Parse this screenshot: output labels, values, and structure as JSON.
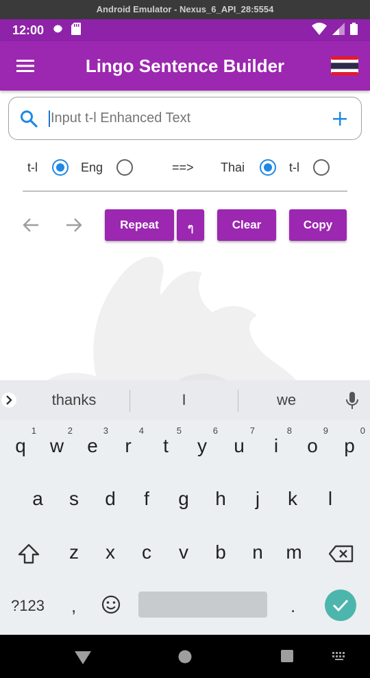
{
  "emulator": {
    "title": "Android Emulator - Nexus_6_API_28:5554"
  },
  "status": {
    "time": "12:00"
  },
  "appbar": {
    "title": "Lingo Sentence Builder"
  },
  "search": {
    "placeholder": "Input t-l Enhanced Text"
  },
  "radios": {
    "left": [
      {
        "label": "t-l",
        "selected": true
      },
      {
        "label": "Eng",
        "selected": false
      }
    ],
    "arrow": "==>",
    "right": [
      {
        "label": "Thai",
        "selected": true
      },
      {
        "label": "t-l",
        "selected": false
      }
    ]
  },
  "actions": {
    "repeat": "Repeat",
    "thai_char": "ๆ",
    "clear": "Clear",
    "copy": "Copy"
  },
  "keyboard": {
    "suggestions": [
      "thanks",
      "I",
      "we"
    ],
    "row1": [
      {
        "k": "q",
        "n": "1"
      },
      {
        "k": "w",
        "n": "2"
      },
      {
        "k": "e",
        "n": "3"
      },
      {
        "k": "r",
        "n": "4"
      },
      {
        "k": "t",
        "n": "5"
      },
      {
        "k": "y",
        "n": "6"
      },
      {
        "k": "u",
        "n": "7"
      },
      {
        "k": "i",
        "n": "8"
      },
      {
        "k": "o",
        "n": "9"
      },
      {
        "k": "p",
        "n": "0"
      }
    ],
    "row2": [
      "a",
      "s",
      "d",
      "f",
      "g",
      "h",
      "j",
      "k",
      "l"
    ],
    "row3": [
      "z",
      "x",
      "c",
      "v",
      "b",
      "n",
      "m"
    ],
    "symbols": "?123",
    "comma": ",",
    "period": "."
  },
  "colors": {
    "primary": "#9c27b0",
    "status": "#8e22a8",
    "radio_on": "#1e88e5",
    "enter": "#4db6ac"
  }
}
